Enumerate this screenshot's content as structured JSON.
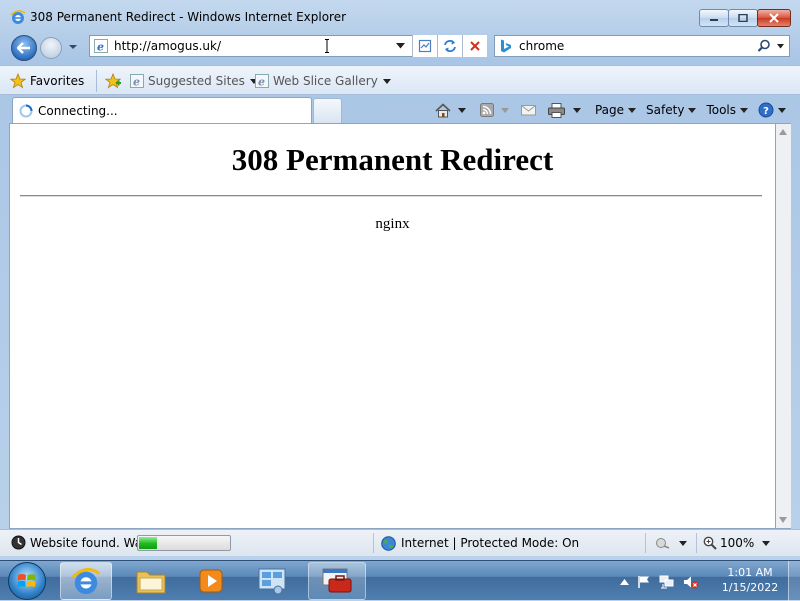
{
  "window": {
    "title": "308 Permanent Redirect - Windows Internet Explorer"
  },
  "address_bar": {
    "url": "http://amogus.uk/"
  },
  "search": {
    "provider_icon": "bing-icon",
    "query": "chrome"
  },
  "favorites_bar": {
    "favorites_label": "Favorites",
    "links": [
      {
        "label": "Suggested Sites"
      },
      {
        "label": "Web Slice Gallery"
      }
    ]
  },
  "tab": {
    "label": "Connecting..."
  },
  "command_bar": {
    "page_label": "Page",
    "safety_label": "Safety",
    "tools_label": "Tools"
  },
  "page": {
    "heading": "308 Permanent Redirect",
    "server": "nginx"
  },
  "status_bar": {
    "text": "Website found. Wai",
    "progress": 0.2,
    "zone": "Internet | Protected Mode: On",
    "zoom": "100%"
  },
  "taskbar": {
    "time": "1:01 AM",
    "date": "1/15/2022"
  },
  "colors": {
    "frame": "#b9d1ea",
    "progress_fill": "#22b822",
    "close_button": "#c73a22"
  }
}
